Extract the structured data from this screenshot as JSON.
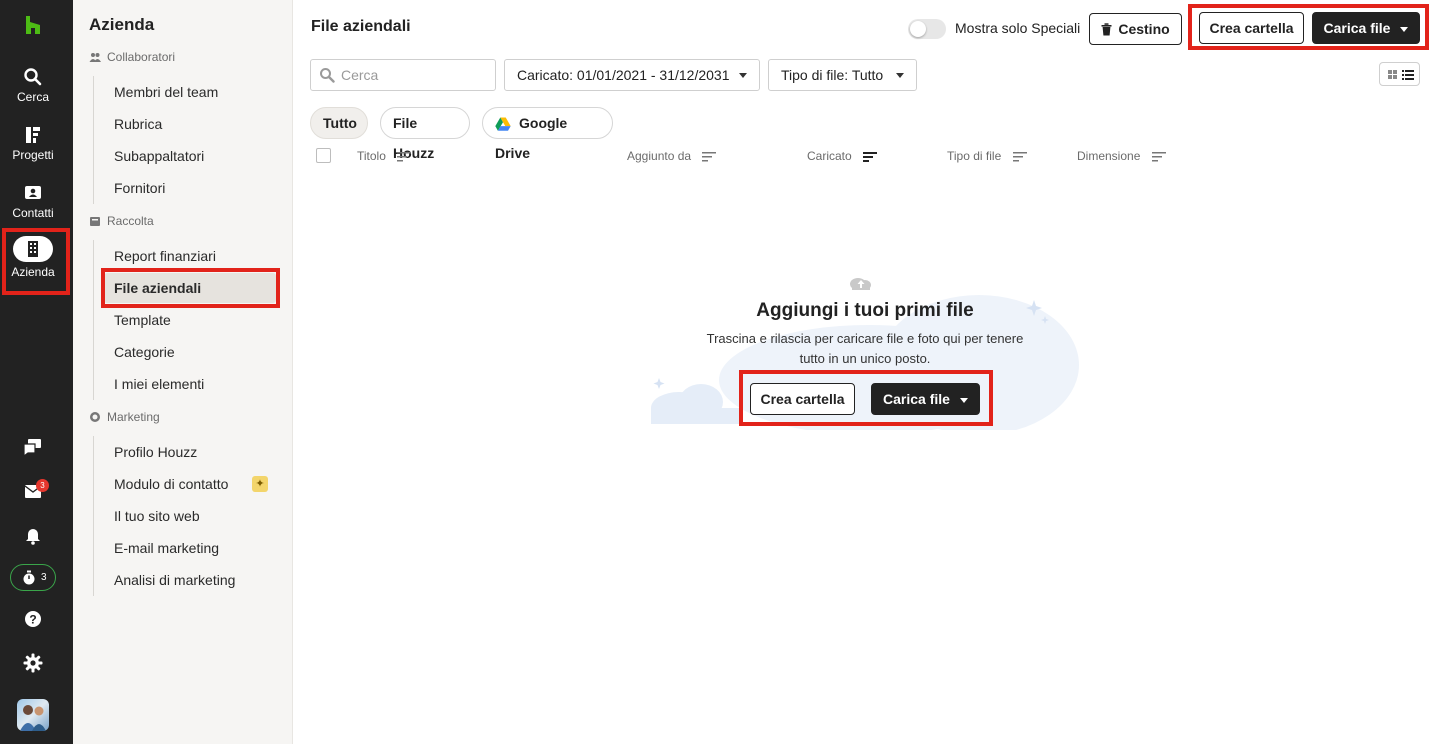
{
  "rail": {
    "items": [
      {
        "label": "Cerca",
        "icon": "search-icon"
      },
      {
        "label": "Progetti",
        "icon": "projects-icon"
      },
      {
        "label": "Contatti",
        "icon": "contacts-icon"
      },
      {
        "label": "Azienda",
        "icon": "building-icon"
      }
    ],
    "inbox_badge": "3",
    "timer_count": "3"
  },
  "secnav": {
    "title": "Azienda",
    "groups": [
      {
        "label": "Collaboratori",
        "items": [
          "Membri del team",
          "Rubrica",
          "Subappaltatori",
          "Fornitori"
        ]
      },
      {
        "label": "Raccolta",
        "items": [
          "Report finanziari",
          "File aziendali",
          "Template",
          "Categorie",
          "I miei elementi"
        ]
      },
      {
        "label": "Marketing",
        "items": [
          "Profilo Houzz",
          "Modulo di contatto",
          "Il tuo sito web",
          "E-mail marketing",
          "Analisi di marketing"
        ]
      }
    ],
    "active_item": "File aziendali",
    "spark_glyph": "✦"
  },
  "header": {
    "title": "File aziendali",
    "toggle_label": "Mostra solo Speciali",
    "trash_label": "Cestino",
    "create_folder_label": "Crea cartella",
    "upload_label": "Carica file"
  },
  "filters": {
    "search_placeholder": "Cerca",
    "uploaded_label": "Caricato: 01/01/2021 - 31/12/2031",
    "filetype_label": "Tipo di file: Tutto"
  },
  "sources": [
    "Tutto",
    "File Houzz",
    "Google Drive"
  ],
  "table": {
    "columns": [
      "Titolo",
      "Aggiunto da",
      "Caricato",
      "Tipo di file",
      "Dimensione"
    ]
  },
  "empty": {
    "title": "Aggiungi i tuoi primi file",
    "subtitle_line1": "Trascina e rilascia per caricare file e foto qui per tenere",
    "subtitle_line2": "tutto in un unico posto.",
    "create_folder_label": "Crea cartella",
    "upload_label": "Carica file"
  },
  "colors": {
    "rail_bg": "#222222",
    "brand_green": "#4dbc15",
    "highlight_red": "#e2231a",
    "cloud": "#eaf1fb"
  }
}
